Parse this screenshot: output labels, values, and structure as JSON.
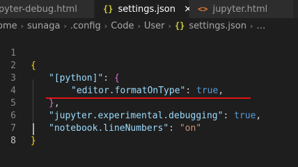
{
  "tabs": [
    {
      "label": "jupyter-debug.html",
      "icon": "html-icon",
      "active": false
    },
    {
      "label": "settings.json",
      "icon": "json-icon",
      "active": true,
      "close_glyph": "×"
    },
    {
      "label": "jupyter.html",
      "icon": "html-icon",
      "active": false
    }
  ],
  "tab_icons": {
    "json_glyph": "{}",
    "html_glyph": "<>"
  },
  "breadcrumb": {
    "items": [
      "ome",
      "sunaga",
      ".config",
      "Code",
      "User"
    ],
    "file": "settings.json",
    "json_glyph": "{}",
    "trailing": "…",
    "separator": "›"
  },
  "editor": {
    "line_numbers": [
      "1",
      "2",
      "3",
      "4",
      "5",
      "6",
      "7",
      "8"
    ],
    "current_line": "8",
    "lines": {
      "l1_open": "{",
      "l2_key": "\"[python]\"",
      "l2_colon": ": ",
      "l2_open": "{",
      "l3_key": "\"editor.formatOnType\"",
      "l3_colon": ": ",
      "l3_val": "true",
      "l3_comma": ",",
      "l4_close": "}",
      "l4_comma": ",",
      "l5_key": "\"jupyter.experimental.debugging\"",
      "l5_colon": ": ",
      "l5_val": "true",
      "l5_comma": ",",
      "l6_key": "\"notebook.lineNumbers\"",
      "l6_colon": ": ",
      "l6_val": "\"on\"",
      "l7_close": "}"
    }
  },
  "colors": {
    "background": "#1e1e1e",
    "annotation_underline": "#e31414",
    "json_key": "#9cdcfe",
    "json_string": "#ce9178",
    "json_bool": "#569cd6"
  }
}
